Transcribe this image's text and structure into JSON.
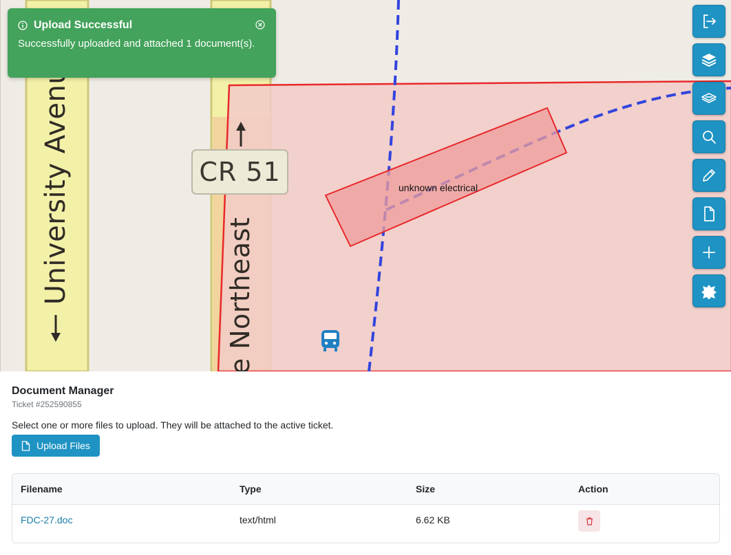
{
  "map": {
    "roads": {
      "university_avenue": "University Avenu",
      "northeast": "e Northeast",
      "route_shield": "CR 51"
    },
    "feature_label": "unknown electrical",
    "colors": {
      "parcel_fill": "#f2cbc7",
      "parcel_stroke": "#e8282a",
      "feature_fill": "#ee9e9c",
      "dashed_line": "#3344dd",
      "road_fill": "#f3f0a8",
      "road_fill_orange": "#f1d49e",
      "background": "#efece6"
    }
  },
  "toast": {
    "title": "Upload Successful",
    "message": "Successfully uploaded and attached 1 document(s).",
    "icon": "info-circle-icon",
    "close_icon": "close-circle-icon",
    "color": "#43a25b"
  },
  "toolbar": {
    "buttons": [
      {
        "name": "exit",
        "icon": "sign-out-icon"
      },
      {
        "name": "layers",
        "icon": "layers-icon"
      },
      {
        "name": "layers-outline",
        "icon": "layers-outline-icon"
      },
      {
        "name": "search",
        "icon": "search-icon"
      },
      {
        "name": "edit",
        "icon": "pencil-icon"
      },
      {
        "name": "documents",
        "icon": "document-icon"
      },
      {
        "name": "add",
        "icon": "plus-icon"
      },
      {
        "name": "tools",
        "icon": "puzzle-icon"
      }
    ],
    "color": "#1f93c3"
  },
  "document_manager": {
    "title": "Document Manager",
    "ticket": "Ticket #252590855",
    "description": "Select one or more files to upload. They will be attached to the active ticket.",
    "upload_label": "Upload Files",
    "table": {
      "headers": [
        "Filename",
        "Type",
        "Size",
        "Action"
      ],
      "rows": [
        {
          "filename": "FDC-27.doc",
          "type": "text/html",
          "size": "6.62 KB",
          "action_icon": "trash-icon"
        }
      ]
    }
  }
}
